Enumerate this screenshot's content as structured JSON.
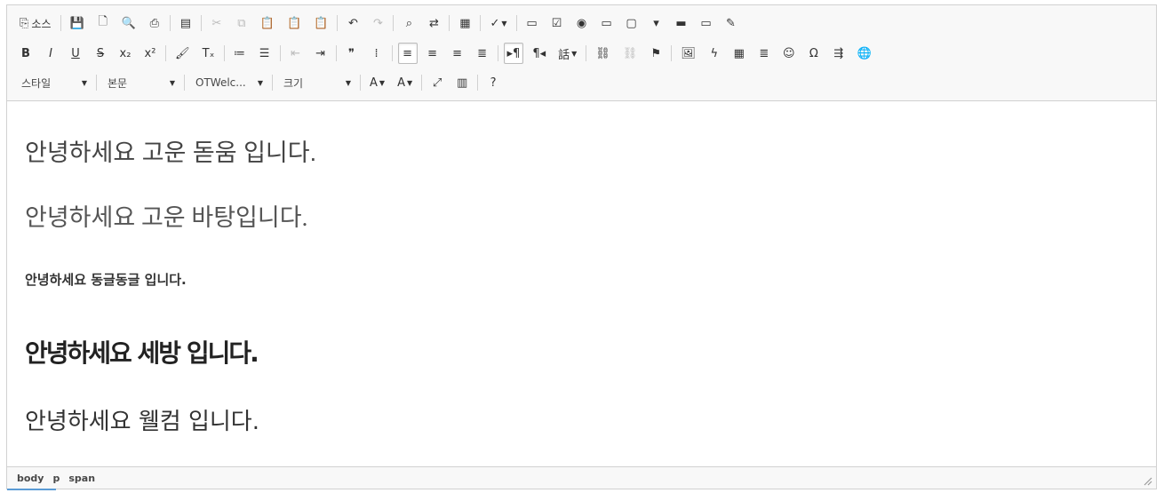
{
  "toolbar": {
    "row1": [
      {
        "name": "source-button",
        "icon": "source-icon",
        "glyph": "⎘",
        "label": "소스"
      },
      {
        "sep": true
      },
      {
        "name": "save-button",
        "icon": "save-icon",
        "glyph": "💾"
      },
      {
        "name": "new-page-button",
        "icon": "new-page-icon",
        "glyph": "🗋"
      },
      {
        "name": "preview-button",
        "icon": "preview-icon",
        "glyph": "🔍"
      },
      {
        "name": "print-button",
        "icon": "print-icon",
        "glyph": "⎙"
      },
      {
        "sep": true
      },
      {
        "name": "templates-button",
        "icon": "templates-icon",
        "glyph": "▤"
      },
      {
        "sep": true
      },
      {
        "name": "cut-button",
        "icon": "cut-icon",
        "glyph": "✂",
        "disabled": true
      },
      {
        "name": "copy-button",
        "icon": "copy-icon",
        "glyph": "⧉",
        "disabled": true
      },
      {
        "name": "paste-button",
        "icon": "paste-icon",
        "glyph": "📋"
      },
      {
        "name": "paste-text-button",
        "icon": "paste-text-icon",
        "glyph": "📋"
      },
      {
        "name": "paste-word-button",
        "icon": "paste-word-icon",
        "glyph": "📋"
      },
      {
        "sep": true
      },
      {
        "name": "undo-button",
        "icon": "undo-icon",
        "glyph": "↶"
      },
      {
        "name": "redo-button",
        "icon": "redo-icon",
        "glyph": "↷",
        "disabled": true
      },
      {
        "sep": true
      },
      {
        "name": "find-button",
        "icon": "find-icon",
        "glyph": "⌕"
      },
      {
        "name": "replace-button",
        "icon": "replace-icon",
        "glyph": "⇄"
      },
      {
        "sep": true
      },
      {
        "name": "select-all-button",
        "icon": "select-all-icon",
        "glyph": "▦"
      },
      {
        "sep": true
      },
      {
        "name": "spellcheck-button",
        "icon": "spellcheck-icon",
        "glyph": "✓",
        "caret": true
      },
      {
        "sep": true
      },
      {
        "name": "form-button",
        "icon": "form-icon",
        "glyph": "▭"
      },
      {
        "name": "checkbox-button",
        "icon": "checkbox-icon",
        "glyph": "☑"
      },
      {
        "name": "radio-button",
        "icon": "radio-icon",
        "glyph": "◉"
      },
      {
        "name": "text-field-button",
        "icon": "text-field-icon",
        "glyph": "▭"
      },
      {
        "name": "textarea-button",
        "icon": "textarea-icon",
        "glyph": "▢"
      },
      {
        "name": "select-field-button",
        "icon": "select-field-icon",
        "glyph": "▾"
      },
      {
        "name": "form-button-button",
        "icon": "button-icon",
        "glyph": "▬"
      },
      {
        "name": "image-button-button",
        "icon": "image-button-icon",
        "glyph": "▭"
      },
      {
        "name": "hidden-field-button",
        "icon": "hidden-field-icon",
        "glyph": "✎"
      }
    ],
    "row2": [
      {
        "name": "bold-button",
        "icon": "bold-icon",
        "glyph": "B",
        "cls": "b"
      },
      {
        "name": "italic-button",
        "icon": "italic-icon",
        "glyph": "I",
        "cls": "i"
      },
      {
        "name": "underline-button",
        "icon": "underline-icon",
        "glyph": "U",
        "cls": "u"
      },
      {
        "name": "strike-button",
        "icon": "strikethrough-icon",
        "glyph": "S",
        "cls": "s"
      },
      {
        "name": "subscript-button",
        "icon": "subscript-icon",
        "glyph": "x₂"
      },
      {
        "name": "superscript-button",
        "icon": "superscript-icon",
        "glyph": "x²"
      },
      {
        "sep": true
      },
      {
        "name": "copy-format-button",
        "icon": "brush-icon",
        "glyph": "🖌"
      },
      {
        "name": "remove-format-button",
        "icon": "remove-format-icon",
        "glyph": "Tₓ"
      },
      {
        "sep": true
      },
      {
        "name": "numbered-list-button",
        "icon": "numbered-list-icon",
        "glyph": "≔"
      },
      {
        "name": "bulleted-list-button",
        "icon": "bulleted-list-icon",
        "glyph": "☰"
      },
      {
        "sep": true
      },
      {
        "name": "outdent-button",
        "icon": "outdent-icon",
        "glyph": "⇤",
        "disabled": true
      },
      {
        "name": "indent-button",
        "icon": "indent-icon",
        "glyph": "⇥"
      },
      {
        "sep": true
      },
      {
        "name": "blockquote-button",
        "icon": "blockquote-icon",
        "glyph": "❞"
      },
      {
        "name": "div-button",
        "icon": "div-container-icon",
        "glyph": "⁞"
      },
      {
        "sep": true
      },
      {
        "name": "align-left-button",
        "icon": "align-left-icon",
        "glyph": "≡",
        "active": true
      },
      {
        "name": "align-center-button",
        "icon": "align-center-icon",
        "glyph": "≡"
      },
      {
        "name": "align-right-button",
        "icon": "align-right-icon",
        "glyph": "≡"
      },
      {
        "name": "justify-button",
        "icon": "justify-icon",
        "glyph": "≣"
      },
      {
        "sep": true
      },
      {
        "name": "ltr-button",
        "icon": "text-direction-ltr-icon",
        "glyph": "▸¶",
        "active": true
      },
      {
        "name": "rtl-button",
        "icon": "text-direction-rtl-icon",
        "glyph": "¶◂"
      },
      {
        "name": "language-button",
        "icon": "language-icon",
        "glyph": "話",
        "caret": true
      },
      {
        "sep": true
      },
      {
        "name": "link-button",
        "icon": "link-icon",
        "glyph": "⛓"
      },
      {
        "name": "unlink-button",
        "icon": "unlink-icon",
        "glyph": "⛓",
        "disabled": true
      },
      {
        "name": "anchor-button",
        "icon": "flag-icon",
        "glyph": "⚑"
      },
      {
        "sep": true
      },
      {
        "name": "image-button",
        "icon": "image-icon",
        "glyph": "🖼"
      },
      {
        "name": "flash-button",
        "icon": "flash-icon",
        "glyph": "ϟ"
      },
      {
        "name": "table-button",
        "icon": "table-icon",
        "glyph": "▦"
      },
      {
        "name": "horizontal-line-button",
        "icon": "horizontal-line-icon",
        "glyph": "≣"
      },
      {
        "name": "smiley-button",
        "icon": "smiley-icon",
        "glyph": "☺"
      },
      {
        "name": "special-char-button",
        "icon": "omega-icon",
        "glyph": "Ω"
      },
      {
        "name": "page-break-button",
        "icon": "page-break-icon",
        "glyph": "⇶"
      },
      {
        "name": "iframe-button",
        "icon": "globe-icon",
        "glyph": "🌐"
      }
    ],
    "row3": {
      "styles_label": "스타일",
      "format_label": "본문",
      "font_label": "OTWelc...",
      "size_label": "크기",
      "buttons": [
        {
          "name": "text-color-button",
          "icon": "text-color-icon",
          "glyph": "A",
          "caret": true
        },
        {
          "name": "bg-color-button",
          "icon": "bg-color-icon",
          "glyph": "A",
          "caret": true
        },
        {
          "sep": true
        },
        {
          "name": "maximize-button",
          "icon": "maximize-icon",
          "glyph": "⤢"
        },
        {
          "name": "show-blocks-button",
          "icon": "show-blocks-icon",
          "glyph": "▥"
        },
        {
          "sep": true
        },
        {
          "name": "about-button",
          "icon": "help-icon",
          "glyph": "?"
        }
      ]
    }
  },
  "content": {
    "lines": [
      "안녕하세요 고운 돋움 입니다.",
      "안녕하세요 고운 바탕입니다.",
      "안녕하세요 동글동글 입니다.",
      "안녕하세요 세방 입니다.",
      "안녕하세요 웰컴 입니다."
    ]
  },
  "status": {
    "path": [
      "body",
      "p",
      "span"
    ]
  }
}
